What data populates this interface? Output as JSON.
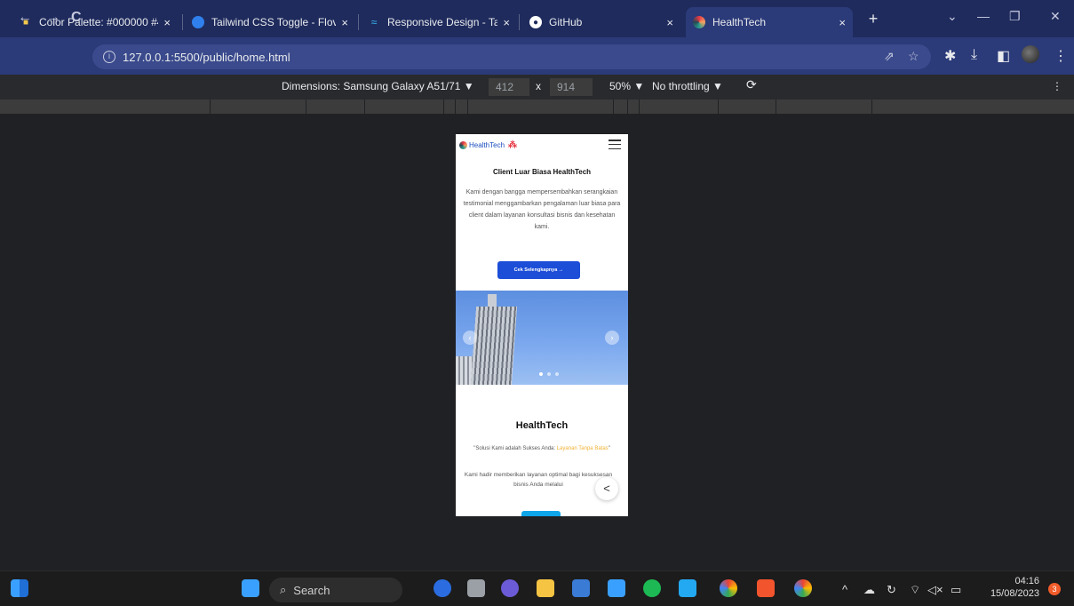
{
  "browser": {
    "tabs": [
      {
        "title": "Color Palette: #000000 #4",
        "favicon": "palette-favicon",
        "color": "#f2c94c"
      },
      {
        "title": "Tailwind CSS Toggle - Flov",
        "favicon": "flowbite-favicon",
        "color": "#2f80ed"
      },
      {
        "title": "Responsive Design - Tailw",
        "favicon": "tailwind-favicon",
        "color": "#38bdf8"
      },
      {
        "title": "GitHub",
        "favicon": "github-favicon",
        "color": "#ffffff"
      },
      {
        "title": "HealthTech",
        "favicon": "healthtech-favicon",
        "color": "#e63946",
        "active": true
      }
    ],
    "url": "127.0.0.1:5500/public/home.html",
    "close_glyph": "×",
    "new_tab_glyph": "+"
  },
  "devtools": {
    "device_label": "Dimensions: Samsung Galaxy A51/71 ▼",
    "width": "412",
    "times": "x",
    "height": "914",
    "zoom": "50% ▼",
    "throttling": "No throttling ▼"
  },
  "page": {
    "logo_text": "HealthTech",
    "heading": "Client Luar Biasa HealthTech",
    "paragraph": "Kami dengan bangga mempersembahkan serangkaian testimonial menggambarkan pengalaman luar biasa para client dalam layanan konsultasi bisnis dan kesehatan kami.",
    "cta_label": "Cek Selengkapnya →",
    "carousel_prev": "‹",
    "carousel_next": "›",
    "section_title": "HealthTech",
    "quote_prefix": "\"Solusi Kami adalah Sukses Anda: ",
    "quote_highlight": "Layanan Tanpa Batas",
    "quote_suffix": "\"",
    "section_paragraph": "Kami hadir memberikan layanan optimal bagi kesuksesan bisnis Anda melalui",
    "share_glyph": "<"
  },
  "taskbar": {
    "search_label": "Search",
    "time": "04:16",
    "date": "15/08/2023",
    "notifications": "3"
  }
}
